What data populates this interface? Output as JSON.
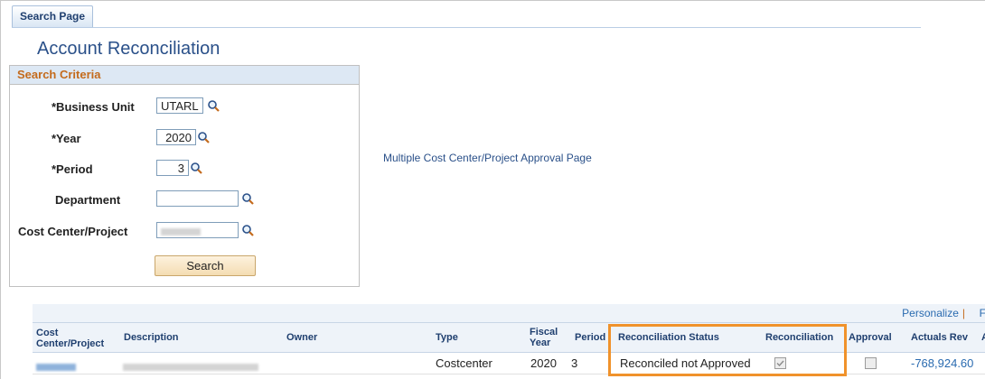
{
  "tab": {
    "label": "Search Page"
  },
  "page": {
    "title": "Account Reconciliation"
  },
  "search_criteria": {
    "header": "Search Criteria",
    "business_unit": {
      "label": "*Business Unit",
      "value": "UTARL"
    },
    "year": {
      "label": "*Year",
      "value": "2020"
    },
    "period": {
      "label": "*Period",
      "value": "3"
    },
    "department": {
      "label": "Department",
      "value": ""
    },
    "cost_center": {
      "label": "Cost Center/Project"
    },
    "search_button": "Search"
  },
  "approval_link": "Multiple Cost Center/Project Approval Page",
  "grid": {
    "personalize": "Personalize",
    "separator": "|",
    "trailing_link": "F",
    "columns": {
      "cost_center_l1": "Cost",
      "cost_center_l2": "Center/Project",
      "description": "Description",
      "owner": "Owner",
      "type": "Type",
      "fiscal_year_l1": "Fiscal",
      "fiscal_year_l2": "Year",
      "period": "Period",
      "reconciliation_status": "Reconciliation Status",
      "reconciliation": "Reconciliation",
      "approval": "Approval",
      "actuals_rev": "Actuals Rev",
      "next": "A"
    },
    "row": {
      "type": "Costcenter",
      "fiscal_year": "2020",
      "period": "3",
      "reconciliation_status": "Reconciled not Approved",
      "reconciliation_checked": true,
      "approval_checked": false,
      "actuals_rev": "-768,924.60"
    }
  },
  "colors": {
    "accent": "#f0922b",
    "title_blue": "#2a5089",
    "header_orange": "#c46b1d",
    "negative_value": "#2a6bb0"
  }
}
